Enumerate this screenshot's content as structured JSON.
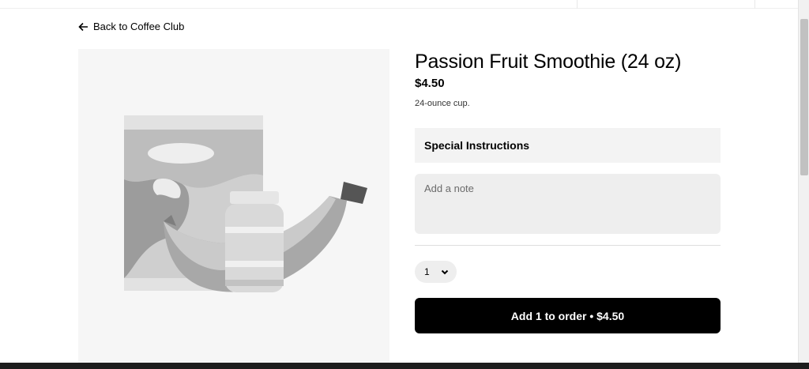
{
  "nav": {
    "back_label": "Back to Coffee Club"
  },
  "item": {
    "title": "Passion Fruit Smoothie (24 oz)",
    "price": "$4.50",
    "description": "24-ounce cup."
  },
  "special_instructions": {
    "heading": "Special Instructions",
    "note_placeholder": "Add a note",
    "note_value": ""
  },
  "quantity": {
    "selected": "1"
  },
  "add_button": {
    "label": "Add 1 to order • $4.50"
  },
  "colors": {
    "primary": "#000000",
    "surface": "#f3f3f3",
    "input": "#eeeeee",
    "image_bg": "#f6f6f6"
  },
  "icons": {
    "back": "arrow-left-icon",
    "quantity": "chevron-down-icon",
    "placeholder_image": "grocery-placeholder-illustration"
  }
}
